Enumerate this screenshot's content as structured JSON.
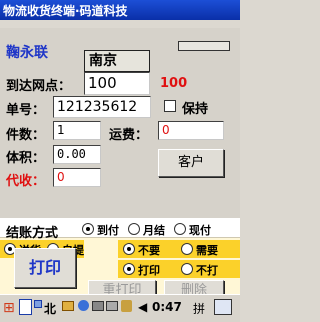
{
  "window": {
    "title": "物流收货终端·码道科技"
  },
  "form": {
    "company": "鞠永联",
    "city": "南京",
    "arrival_label": "到达网点：",
    "arrival_value": "100",
    "arrival_echo": "100",
    "order_label": "单号：",
    "order_value": "121235612",
    "keep_label": "保持",
    "pieces_label": "件数：",
    "pieces_value": "1",
    "freight_label": "运费：",
    "freight_value": "0",
    "volume_label": "体积：",
    "volume_value": "0.00",
    "cod_label": "代收：",
    "cod_value": "0",
    "customer_button": "客户"
  },
  "options": {
    "settle_label": "结账方式",
    "settle": [
      "到付",
      "月结",
      "现付"
    ],
    "delivery": [
      "送货",
      "自提"
    ],
    "need": [
      "不要",
      "需要"
    ],
    "print_opts": [
      "打印",
      "不打"
    ]
  },
  "actions": {
    "print": "打印",
    "reprint": "重打印",
    "delete": "删除"
  },
  "taskbar": {
    "ime": "北",
    "time": "0:47",
    "input_mode": "拼"
  }
}
